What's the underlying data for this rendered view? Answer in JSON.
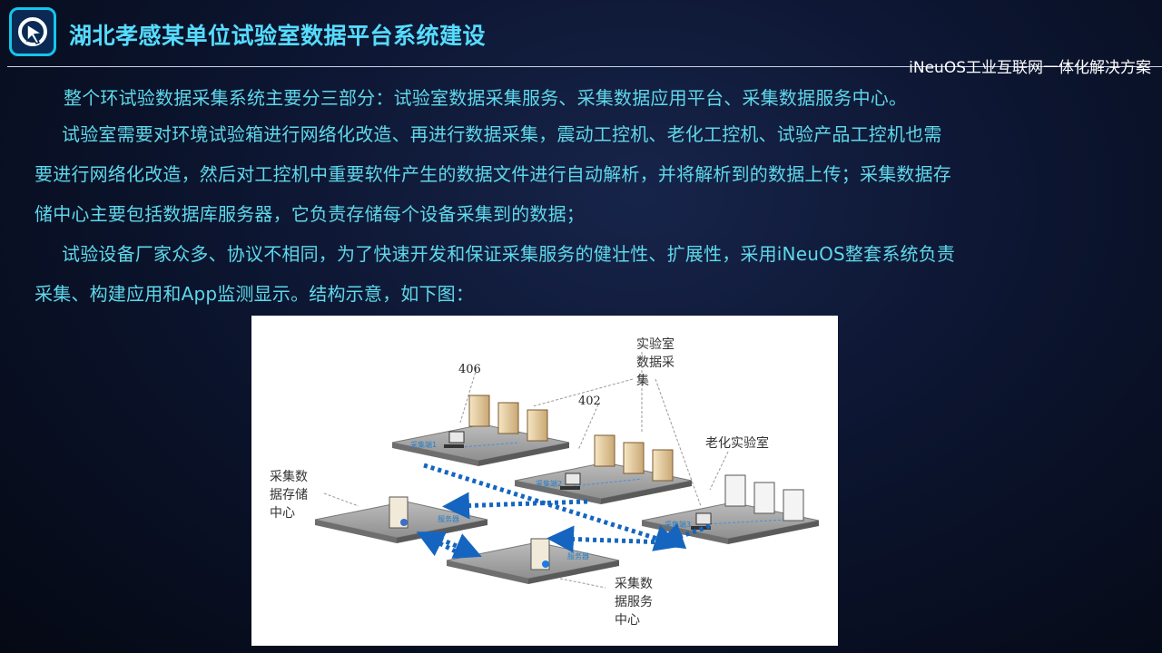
{
  "header": {
    "logo_icon": "ineuos-cursor-logo-icon",
    "title": "湖北孝感某单位试验室数据平台系统建设",
    "subtitle": "iNeuOS工业互联网一体化解决方案"
  },
  "content": {
    "p1": "整个环试验数据采集系统主要分三部分：试验室数据采集服务、采集数据应用平台、采集数据服务中心。",
    "p2_line1": "试验室需要对环境试验箱进行网络化改造、再进行数据采集，震动工控机、老化工控机、试验产品工控机也需",
    "p2_line2": "要进行网络化改造，然后对工控机中重要软件产生的数据文件进行自动解析，并将解析到的数据上传；采集数据存",
    "p2_line3": "储中心主要包括数据库服务器，它负责存储每个设备采集到的数据；",
    "p3_line1": "试验设备厂家众多、协议不相同，为了快速开发和保证采集服务的健壮性、扩展性，采用iNeuOS整套系统负责",
    "p3_line2": "采集、构建应用和App监测显示。结构示意，如下图："
  },
  "diagram": {
    "label_406": "406",
    "label_402": "402",
    "label_lab_l1": "实验室",
    "label_lab_l2": "数据采",
    "label_lab_l3": "集",
    "label_aging": "老化实验室",
    "label_store_l1": "采集数",
    "label_store_l2": "据存储",
    "label_store_l3": "中心",
    "label_service_l1": "采集数",
    "label_service_l2": "据服务",
    "label_service_l3": "中心",
    "tag_collector1": "采集端1",
    "tag_collector2": "采集端2",
    "tag_collector3": "采集端3",
    "tag_server1": "服务器",
    "tag_server2": "服务器",
    "accent_color": "#1565c0"
  }
}
